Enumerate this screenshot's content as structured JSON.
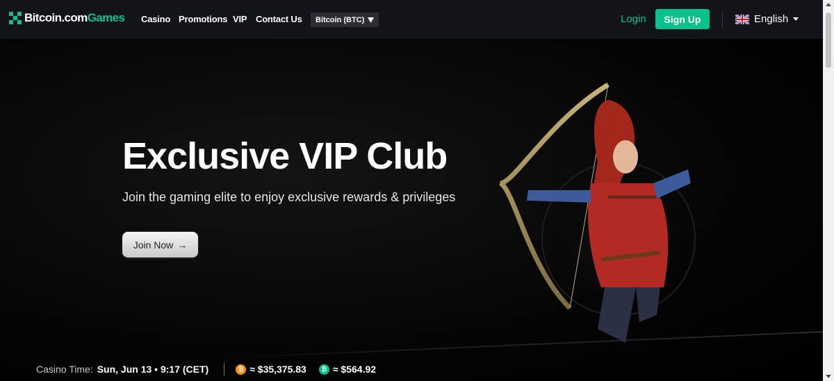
{
  "nav": {
    "logo_main": "Bitcoin.com",
    "logo_accent": "Games",
    "links": [
      "Casino",
      "Promotions",
      "VIP",
      "Contact Us"
    ],
    "currency_selector": "Bitcoin (BTC)",
    "login": "Login",
    "signup": "Sign Up",
    "language": "English"
  },
  "hero": {
    "title": "Exclusive VIP Club",
    "subtitle": "Join the gaming elite to enjoy exclusive rewards & privileges",
    "cta": "Join Now",
    "cta_arrow": "→"
  },
  "ticker": {
    "time_label": "Casino Time:",
    "time_value": "Sun, Jun 13 • 9:17 (CET)",
    "btc_price": "≈ $35,375.83",
    "bch_price": "≈ $564.92"
  },
  "colors": {
    "accent": "#0ac18e",
    "nav_bg": "#131418",
    "btc": "#f7931a",
    "bch": "#0ac18e"
  },
  "icons": {
    "logo": "bitcoin-com-games-logo",
    "currency_caret": "caret-down-icon",
    "language_flag": "uk-flag-icon",
    "language_caret": "caret-down-icon",
    "btc": "bitcoin-icon",
    "bch": "bitcoin-cash-icon",
    "cta_arrow": "arrow-right-icon"
  }
}
